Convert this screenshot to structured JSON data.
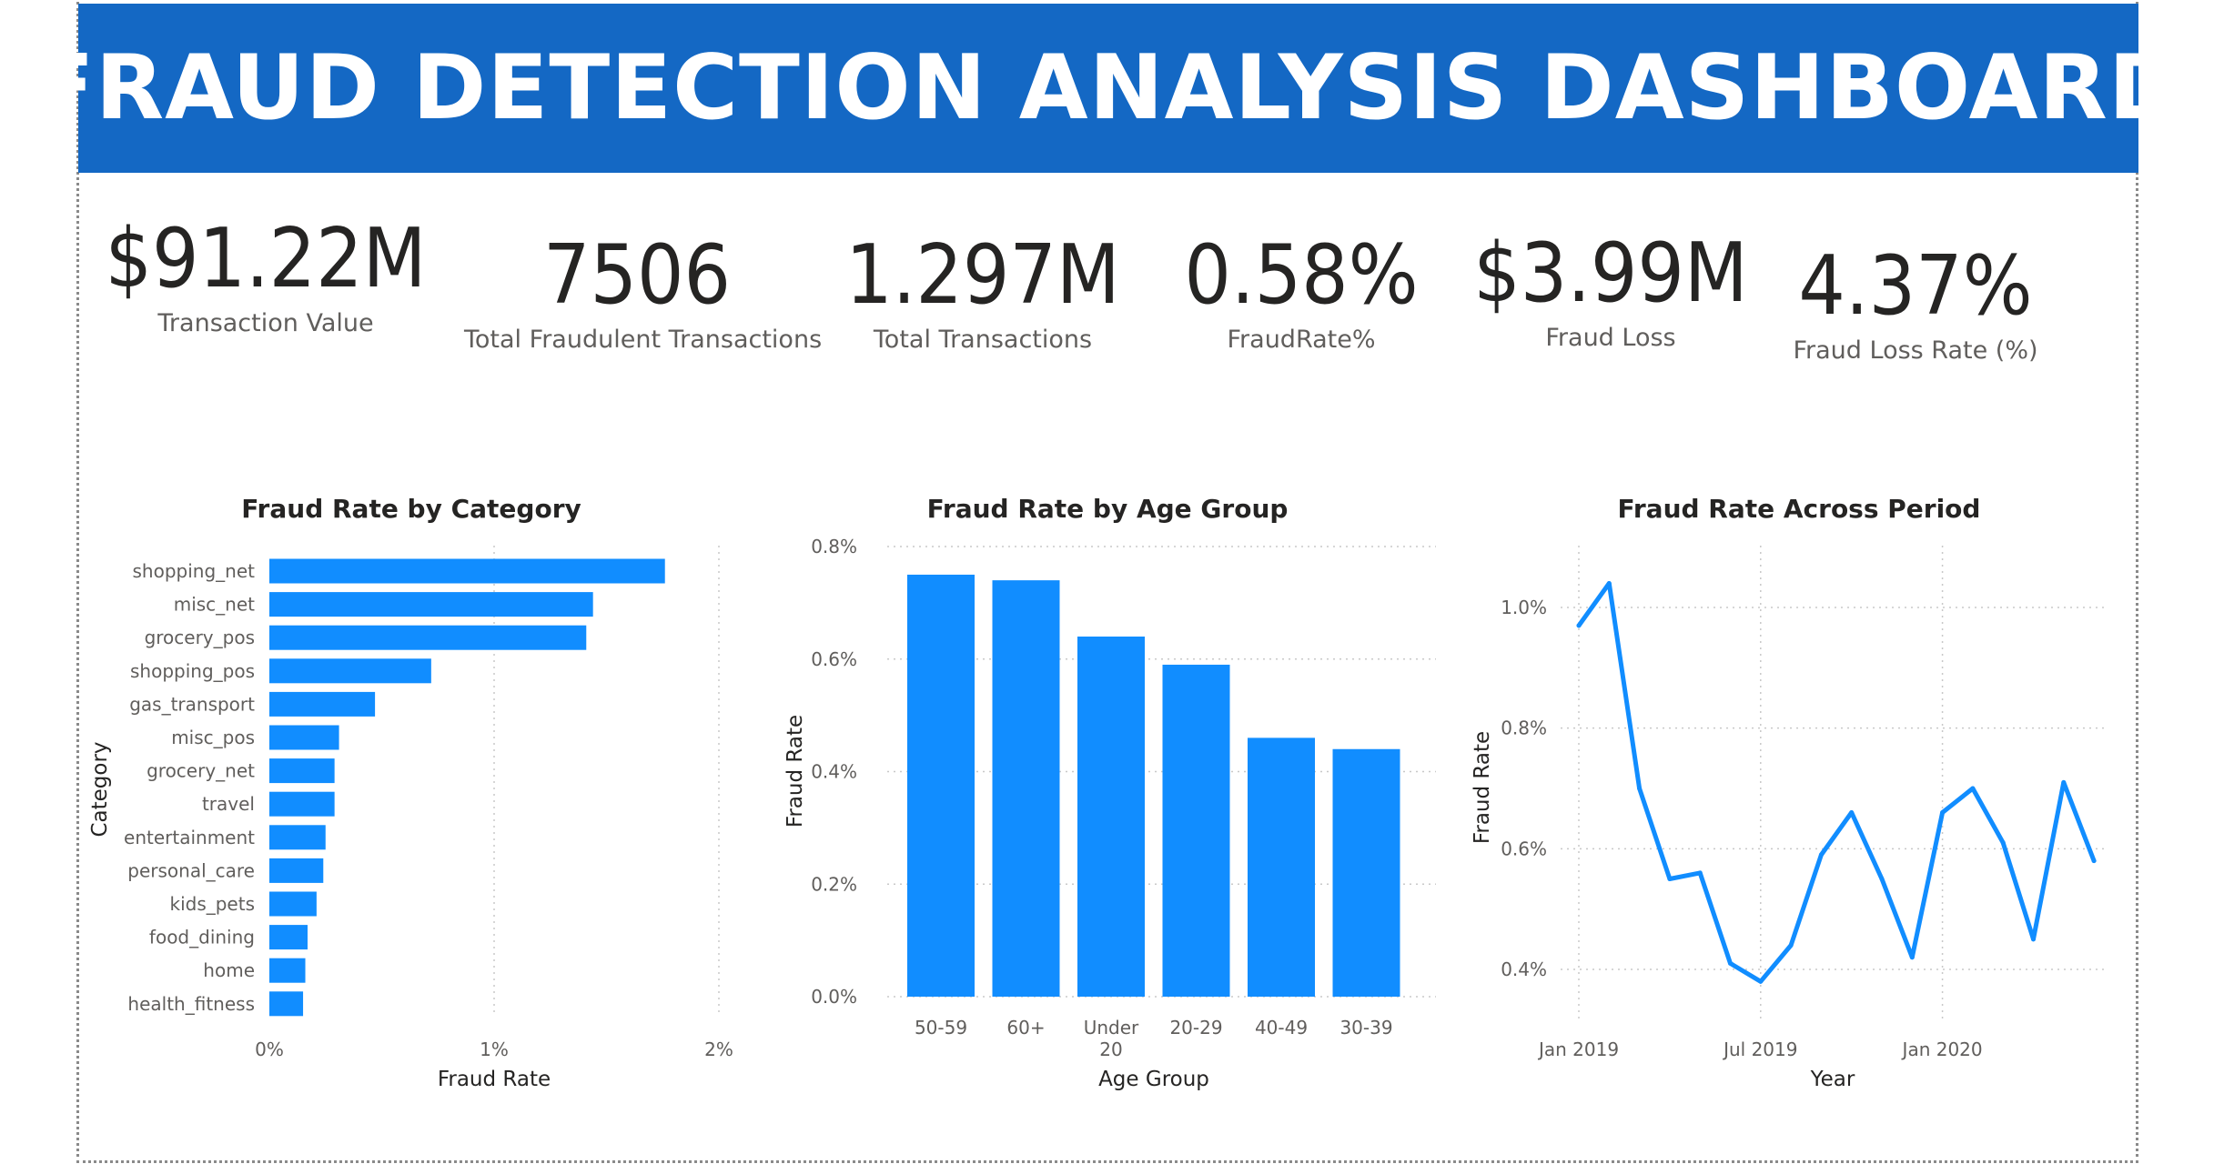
{
  "header": {
    "title": "FRAUD DETECTION ANALYSIS DASHBOARD"
  },
  "colors": {
    "banner": "#1468c4",
    "series": "#118dff"
  },
  "kpis": [
    {
      "value": "$91.22M",
      "label": "Transaction Value"
    },
    {
      "value": "7506",
      "label": "Total Fraudulent Transactions"
    },
    {
      "value": "1.297M",
      "label": "Total Transactions"
    },
    {
      "value": "0.58%",
      "label": "FraudRate%"
    },
    {
      "value": "$3.99M",
      "label": "Fraud Loss"
    },
    {
      "value": "4.37%",
      "label": "Fraud Loss Rate (%)"
    }
  ],
  "chart_data": [
    {
      "type": "bar",
      "orientation": "horizontal",
      "title": "Fraud Rate by Category",
      "xlabel": "Fraud Rate",
      "ylabel": "Category",
      "xlim": [
        0,
        2
      ],
      "x_unit": "%",
      "x_ticks": [
        "0%",
        "1%",
        "2%"
      ],
      "grid": true,
      "categories": [
        "shopping_net",
        "misc_net",
        "grocery_pos",
        "shopping_pos",
        "gas_transport",
        "misc_pos",
        "grocery_net",
        "travel",
        "entertainment",
        "personal_care",
        "kids_pets",
        "food_dining",
        "home",
        "health_fitness"
      ],
      "values": [
        1.76,
        1.44,
        1.41,
        0.72,
        0.47,
        0.31,
        0.29,
        0.29,
        0.25,
        0.24,
        0.21,
        0.17,
        0.16,
        0.15
      ]
    },
    {
      "type": "bar",
      "orientation": "vertical",
      "title": "Fraud Rate by Age Group",
      "xlabel": "Age Group",
      "ylabel": "Fraud Rate",
      "ylim": [
        0,
        0.8
      ],
      "y_unit": "%",
      "y_ticks": [
        "0.0%",
        "0.2%",
        "0.4%",
        "0.6%",
        "0.8%"
      ],
      "grid": true,
      "categories": [
        "50-59",
        "60+",
        "Under 20",
        "20-29",
        "40-49",
        "30-39"
      ],
      "values": [
        0.75,
        0.74,
        0.64,
        0.59,
        0.46,
        0.44
      ]
    },
    {
      "type": "line",
      "title": "Fraud Rate Across Period",
      "xlabel": "Year",
      "ylabel": "Fraud Rate",
      "ylim": [
        0.3,
        1.1
      ],
      "y_unit": "%",
      "y_ticks": [
        "0.4%",
        "0.6%",
        "0.8%",
        "1.0%"
      ],
      "x_ticks": [
        "Jan 2019",
        "Jul 2019",
        "Jan 2020"
      ],
      "grid": true,
      "x": [
        "2019-01",
        "2019-02",
        "2019-03",
        "2019-04",
        "2019-05",
        "2019-06",
        "2019-07",
        "2019-08",
        "2019-09",
        "2019-10",
        "2019-11",
        "2019-12",
        "2020-01",
        "2020-02",
        "2020-03",
        "2020-04",
        "2020-05",
        "2020-06"
      ],
      "values": [
        0.97,
        1.04,
        0.7,
        0.55,
        0.56,
        0.41,
        0.38,
        0.44,
        0.59,
        0.66,
        0.55,
        0.42,
        0.66,
        0.7,
        0.61,
        0.45,
        0.71,
        0.58
      ]
    }
  ]
}
